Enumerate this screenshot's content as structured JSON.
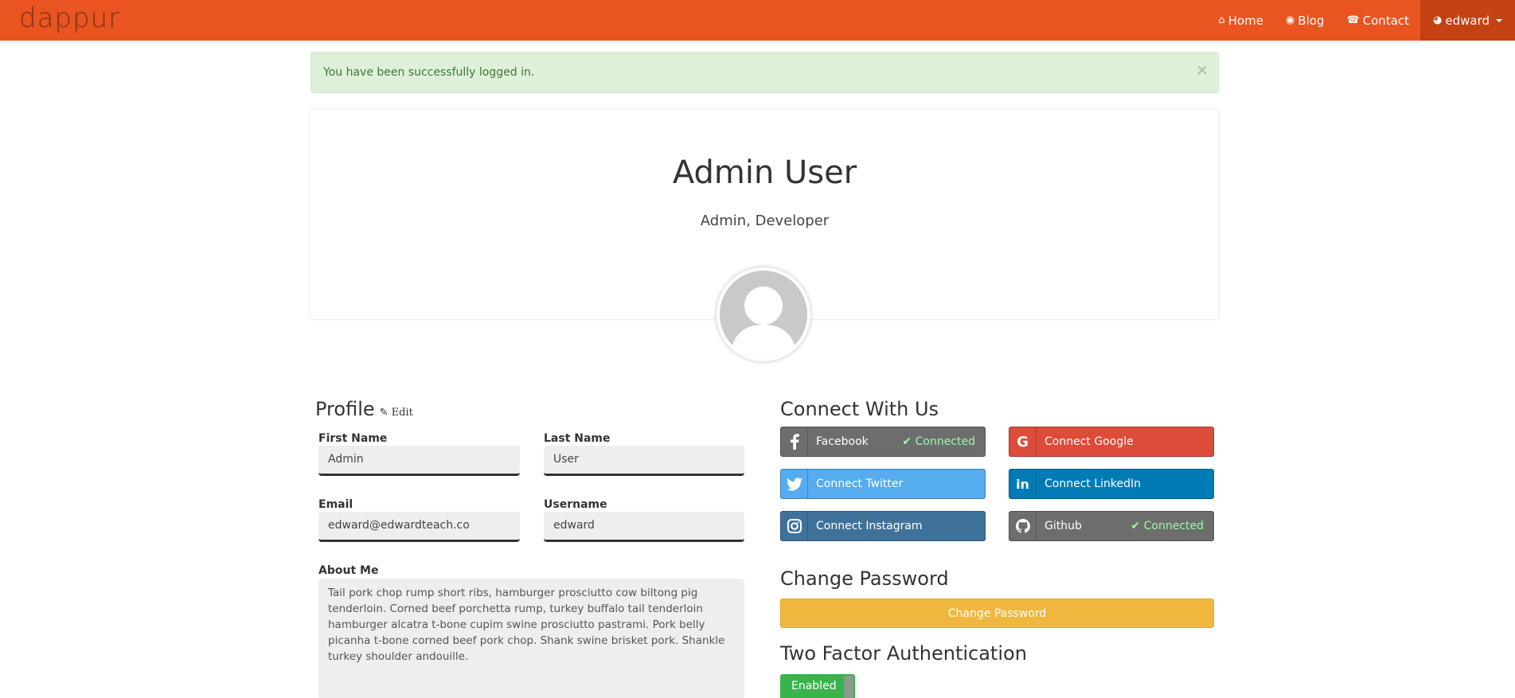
{
  "navbar": {
    "brand": "dappur",
    "items": [
      {
        "icon": "home-icon",
        "glyph": "⌂",
        "label": "Home"
      },
      {
        "icon": "eye-icon",
        "glyph": "◉",
        "label": "Blog"
      },
      {
        "icon": "phone-icon",
        "glyph": "☎",
        "label": "Contact"
      },
      {
        "icon": "user-circle-icon",
        "glyph": "◕",
        "label": "edward"
      }
    ]
  },
  "alert": {
    "message": "You have been successfully logged in.",
    "close": "×"
  },
  "profile_card": {
    "name": "Admin User",
    "roles": "Admin, Developer"
  },
  "profile": {
    "title": "Profile",
    "edit_label": "Edit",
    "first_name_label": "First Name",
    "first_name": "Admin",
    "last_name_label": "Last Name",
    "last_name": "User",
    "email_label": "Email",
    "email": "edward@edwardteach.co",
    "username_label": "Username",
    "username": "edward",
    "about_label": "About Me",
    "about": "Tail pork chop rump short ribs, hamburger prosciutto cow biltong pig tenderloin. Corned beef porchetta rump, turkey buffalo tail tenderloin hamburger alcatra t-bone cupim swine prosciutto pastrami. Pork belly picanha t-bone corned beef pork chop. Shank swine brisket pork. Shankle turkey shoulder andouille."
  },
  "connect": {
    "title": "Connect With Us",
    "buttons": [
      {
        "label": "Facebook",
        "status": "✔ Connected",
        "icon": "facebook-icon",
        "glyph": "f",
        "color": "#6d6d6d"
      },
      {
        "label": "Connect Google",
        "status": "",
        "icon": "google-icon",
        "glyph": "G",
        "color": "#dd4b39"
      },
      {
        "label": "Connect Twitter",
        "status": "",
        "icon": "twitter-icon",
        "glyph": "🐦",
        "color": "#55acee"
      },
      {
        "label": "Connect LinkedIn",
        "status": "",
        "icon": "linkedin-icon",
        "glyph": "in",
        "color": "#007bb6"
      },
      {
        "label": "Connect Instagram",
        "status": "",
        "icon": "instagram-icon",
        "glyph": "◎",
        "color": "#3f729b"
      },
      {
        "label": "Github",
        "status": "✔ Connected",
        "icon": "github-icon",
        "glyph": "◍",
        "color": "#6d6d6d"
      }
    ]
  },
  "password": {
    "title": "Change Password",
    "button": "Change Password"
  },
  "two_factor": {
    "title": "Two Factor Authentication",
    "status": "Enabled"
  },
  "colors": {
    "navbar": "#e95420",
    "navbar_active": "#c34113",
    "success_bg": "#dff0d8",
    "warning": "#efb73e",
    "enabled": "#38b44a"
  }
}
